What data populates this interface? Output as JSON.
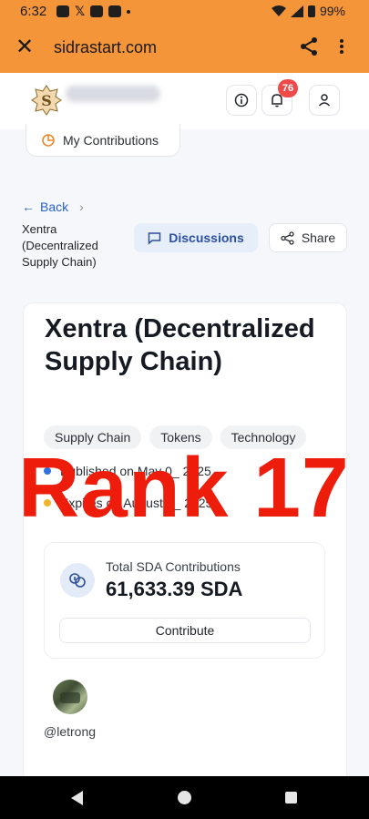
{
  "status_bar": {
    "time": "6:32",
    "battery": "99%"
  },
  "browser": {
    "url": "sidrastart.com"
  },
  "header": {
    "notification_count": "76"
  },
  "my_contributions": {
    "label": "My Contributions"
  },
  "breadcrumb": {
    "back_label": "Back",
    "chevron": "›",
    "current": "Xentra (Decentralized Supply Chain)"
  },
  "actions": {
    "discussions_label": "Discussions",
    "share_label": "Share"
  },
  "project": {
    "title": "Xentra (Decentralized Supply Chain)",
    "tags": [
      "Supply Chain",
      "Tokens",
      "Technology"
    ],
    "published": "Published on May 0_ 2025",
    "expires": "Expires on August 3_ 2025",
    "total_label": "Total SDA Contributions",
    "total_value": "61,633.39 SDA",
    "contribute_label": "Contribute",
    "author_handle": "@letrong"
  },
  "overlay_text": "Rank 17",
  "colors": {
    "brand_orange": "#f4953a",
    "accent_blue": "#2563c9",
    "overlay_red": "#ee1c0a",
    "badge_red": "#ef4a4a"
  }
}
